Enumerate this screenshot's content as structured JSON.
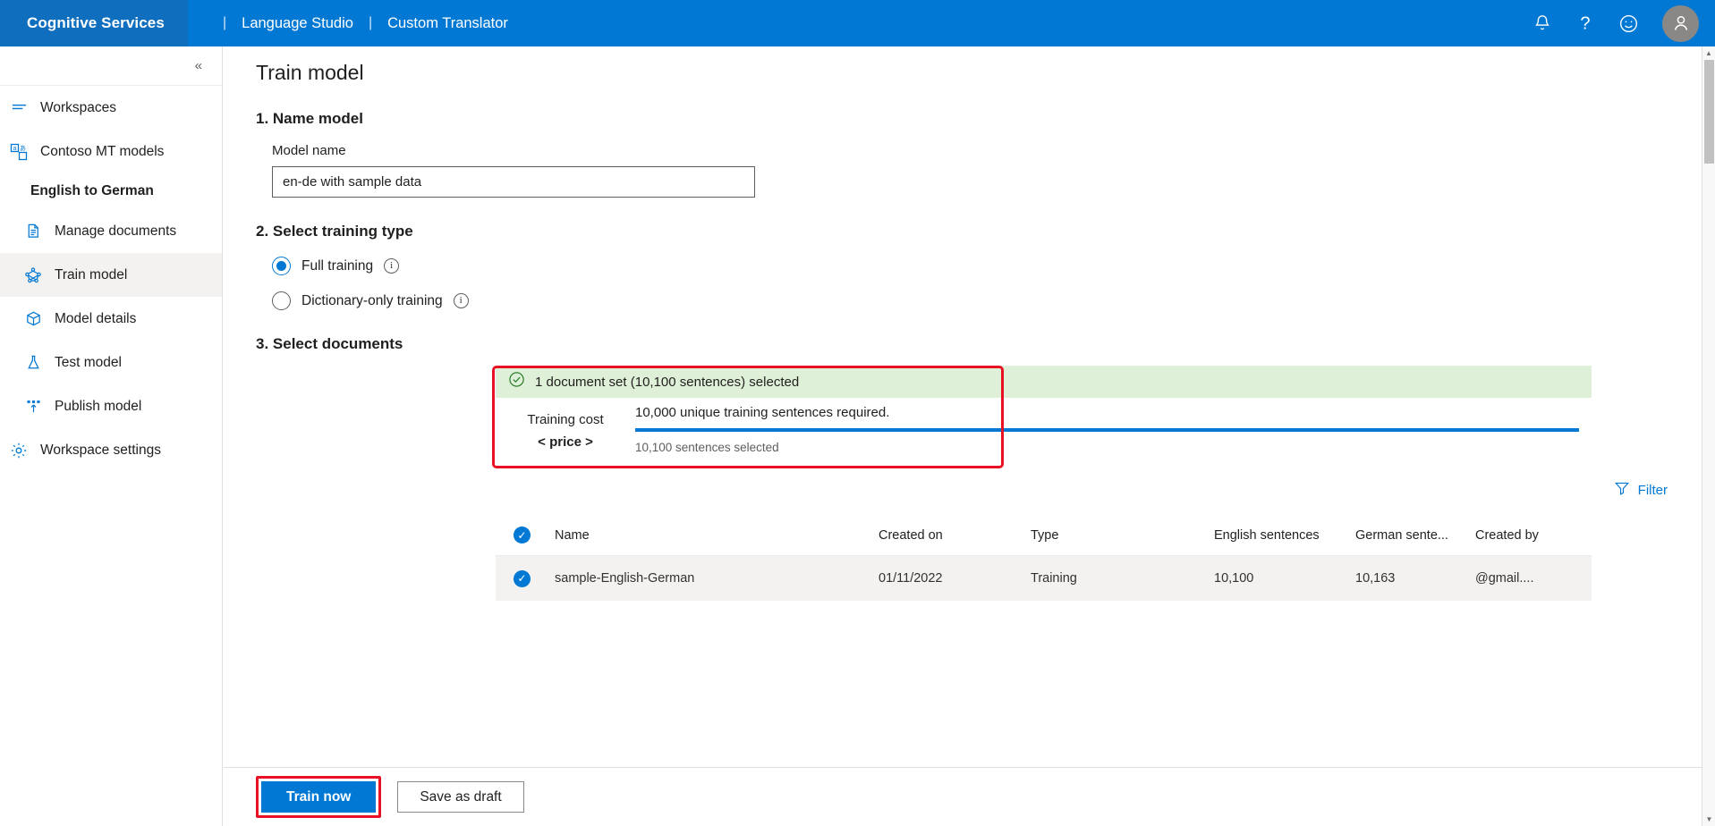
{
  "topbar": {
    "brand": "Cognitive Services",
    "separator": "|",
    "crumb_language_studio": "Language Studio",
    "crumb_custom_translator": "Custom Translator",
    "icons": {
      "bell": "notifications-icon",
      "help": "help-icon",
      "feedback": "feedback-smiley-icon",
      "account": "account-avatar-icon"
    },
    "accent_color": "#0078d4",
    "brand_block_color": "#106ebe"
  },
  "sidebar": {
    "collapse_label": "«",
    "items": [
      {
        "label": "Workspaces",
        "icon": "workspaces-icon",
        "active": false,
        "indent": false
      },
      {
        "label": "Contoso MT models",
        "icon": "translation-models-icon",
        "active": false,
        "indent": false
      }
    ],
    "group_label": "English to German",
    "sub_items": [
      {
        "label": "Manage documents",
        "icon": "document-icon",
        "active": false
      },
      {
        "label": "Train model",
        "icon": "train-model-icon",
        "active": true
      },
      {
        "label": "Model details",
        "icon": "package-box-icon",
        "active": false
      },
      {
        "label": "Test model",
        "icon": "flask-icon",
        "active": false
      },
      {
        "label": "Publish model",
        "icon": "publish-upload-icon",
        "active": false
      }
    ],
    "footer_item": {
      "label": "Workspace settings",
      "icon": "gear-icon"
    }
  },
  "main": {
    "page_title": "Train model",
    "step1": {
      "title": "1. Name model",
      "field_label": "Model name",
      "model_name_value": "en-de with sample data",
      "model_name_placeholder": "Model name"
    },
    "step2": {
      "title": "2. Select training type",
      "options": [
        {
          "label": "Full training",
          "checked": true,
          "info": "info-icon"
        },
        {
          "label": "Dictionary-only training",
          "checked": false,
          "info": "info-icon"
        }
      ]
    },
    "step3": {
      "title": "3. Select documents",
      "banner": {
        "text": "1 document set (10,100 sentences) selected",
        "icon": "check-circle-icon",
        "bg_color": "#dff0d8"
      },
      "cost": {
        "label": "Training cost",
        "price": "< price >"
      },
      "progress": {
        "requirement_text": "10,000 unique training sentences required.",
        "selected_text": "10,100 sentences selected",
        "percent": 100,
        "fill_color": "#0078d4"
      },
      "highlight_color": "#e81123"
    },
    "filter": {
      "label": "Filter",
      "icon": "filter-funnel-icon"
    },
    "table": {
      "select_all_icon": "checkbox-checked-icon",
      "columns": [
        "Name",
        "Created on",
        "Type",
        "English sentences",
        "German sente...",
        "Created by"
      ],
      "rows": [
        {
          "selected": true,
          "name": "sample-English-German",
          "created_on": "01/11/2022",
          "type": "Training",
          "english_sentences": "10,100",
          "german_sentences": "10,163",
          "created_by": "@gmail...."
        }
      ]
    },
    "footer": {
      "train_now": "Train now",
      "save_as_draft": "Save as draft"
    }
  },
  "scrollbar": {
    "up_arrow": "▲",
    "down_arrow": "▼"
  }
}
